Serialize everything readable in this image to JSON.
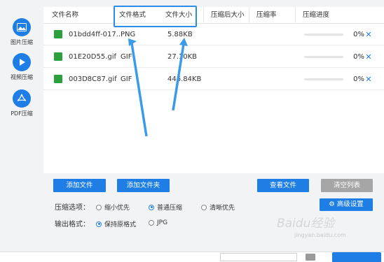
{
  "sidebar": {
    "items": [
      {
        "label": "图片压缩",
        "icon": "image-icon"
      },
      {
        "label": "视频压缩",
        "icon": "play-icon"
      },
      {
        "label": "PDF压缩",
        "icon": "pdf-icon"
      }
    ]
  },
  "table": {
    "columns": [
      "文件名称",
      "文件格式",
      "文件大小",
      "压缩后大小",
      "压缩率",
      "压缩进度"
    ],
    "rows": [
      {
        "name": "01bdd4ff-017...",
        "format": "PNG",
        "size": "5.88KB",
        "progress": "0%"
      },
      {
        "name": "01E20D55.gif",
        "format": "GIF",
        "size": "27.10KB",
        "progress": "0%"
      },
      {
        "name": "003D8C87.gif",
        "format": "GIF",
        "size": "446.84KB",
        "progress": "0%"
      }
    ]
  },
  "buttons": {
    "add_file": "添加文件",
    "add_folder": "添加文件夹",
    "view_file": "查看文件",
    "clear_list": "清空列表",
    "advanced": "高级设置"
  },
  "options": {
    "compress_label": "压缩选项：",
    "compress_choices": [
      "缩小优先",
      "普通压缩",
      "清晰优先"
    ],
    "compress_selected": "普通压缩",
    "format_label": "输出格式：",
    "format_choices": [
      "保持原格式",
      "JPG"
    ],
    "format_selected": "保持原格式"
  },
  "watermark": {
    "text": "Baidu经验",
    "sub": "jingyan.baidu.com"
  },
  "colors": {
    "accent": "#1e7ee6",
    "highlight": "#2b8de8",
    "disabled": "#a6a6a6"
  }
}
